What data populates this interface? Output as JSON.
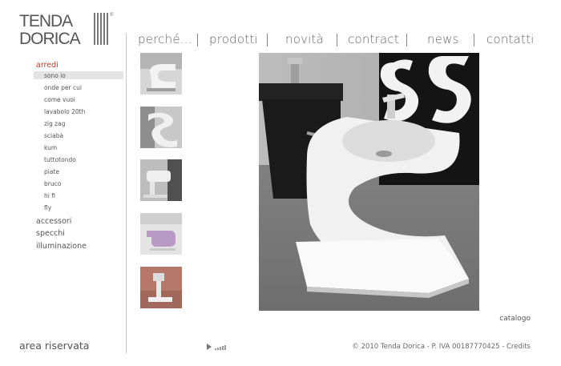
{
  "logo": {
    "line1": "TENDA",
    "line2": "DORICA",
    "mark": "®"
  },
  "nav": [
    {
      "label": "perché...",
      "name": "nav-perche"
    },
    {
      "label": "prodotti",
      "name": "nav-prodotti"
    },
    {
      "label": "novità",
      "name": "nav-novita"
    },
    {
      "label": "contract",
      "name": "nav-contract"
    },
    {
      "label": "news",
      "name": "nav-news"
    },
    {
      "label": "contatti",
      "name": "nav-contatti"
    }
  ],
  "sidebar": {
    "categories": [
      "arredi",
      "accessori",
      "specchi",
      "illuminazione"
    ],
    "subitems": [
      "sono io",
      "onde per cui",
      "come vuoi",
      "lavabolo 20th",
      "zig zag",
      "sciabà",
      "kum",
      "tuttotondo",
      "piate",
      "bruco",
      "hi fi",
      "fly"
    ],
    "area_riservata": "area riservata"
  },
  "catalogo": "catalogo",
  "footer": {
    "copyright": "© 2010 Tenda Dorica - P. IVA 00187770425 - ",
    "credits": "Credits"
  },
  "colors": {
    "accent": "#c0392b",
    "text": "#555555",
    "divider": "#c8c8c8"
  },
  "icons": {
    "player": "play-icon"
  }
}
